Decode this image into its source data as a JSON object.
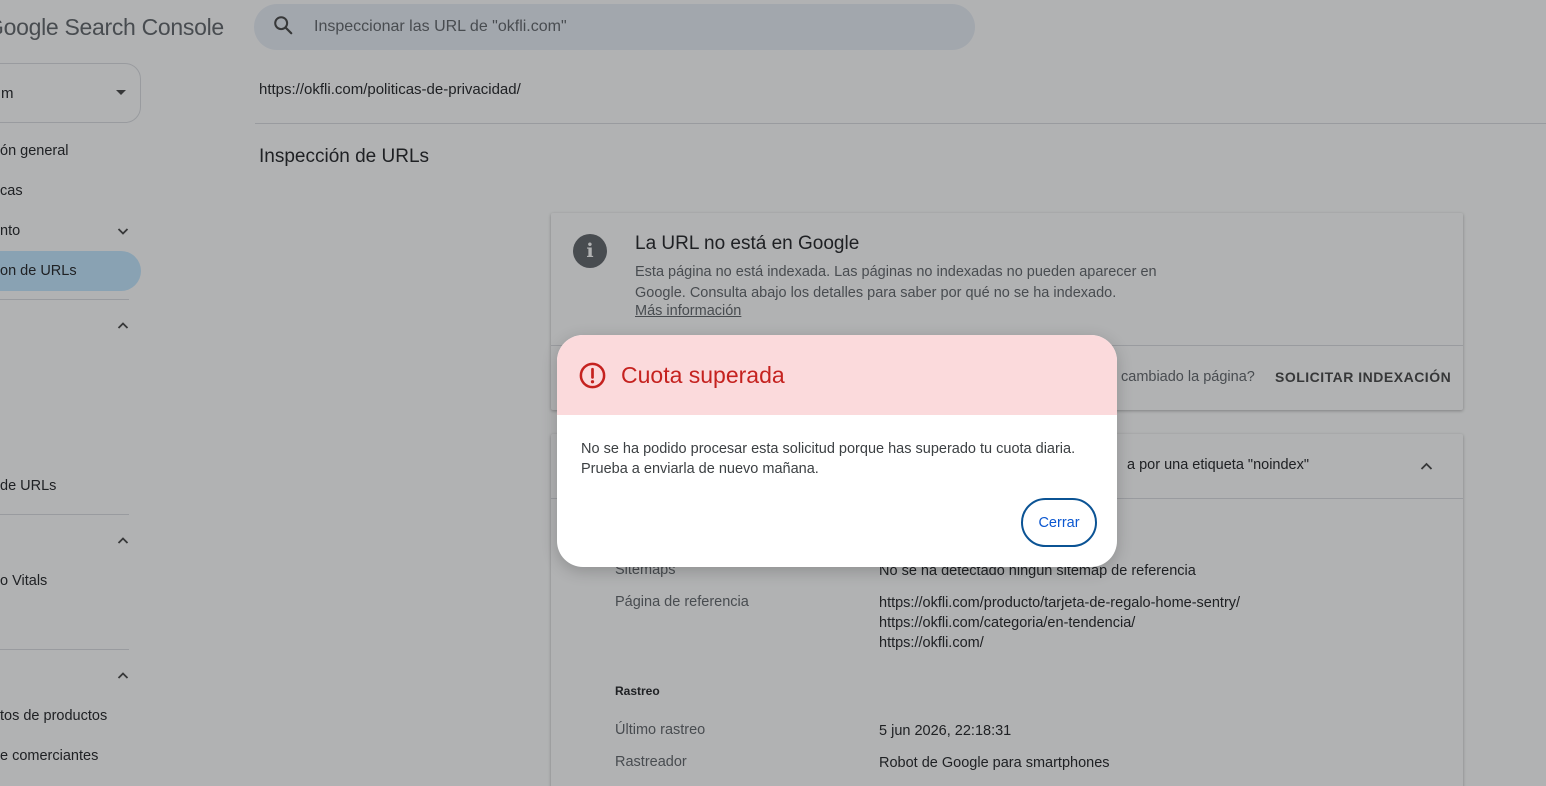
{
  "app": {
    "title": "Google Search Console"
  },
  "search": {
    "placeholder": "Inspeccionar las URL de \"okfli.com\"",
    "icon": "search-icon"
  },
  "property": {
    "label": "m"
  },
  "sidebar": {
    "items": [
      {
        "label": "ón general"
      },
      {
        "label": "cas"
      },
      {
        "label": "nto"
      },
      {
        "label": "on de URLs"
      },
      {
        "label": "de URLs"
      },
      {
        "label": "o Vitals"
      },
      {
        "label": "tos de productos"
      },
      {
        "label": "e comerciantes"
      }
    ]
  },
  "main": {
    "inspected_url": "https://okfli.com/politicas-de-privacidad/",
    "page_title": "Inspección de URLs",
    "status_card": {
      "title": "La URL no está en Google",
      "description": "Esta página no está indexada. Las páginas no indexadas no pueden aparecer en Google. Consulta abajo los detalles para saber por qué no se ha indexado.",
      "link": "Más información",
      "changed_question": "cambiado la página?",
      "request_button": "SOLICITAR INDEXACIÓN"
    },
    "detail_card": {
      "heading": "a por una etiqueta \"noindex\"",
      "rows": [
        {
          "label": "Sitemaps",
          "value": "No se ha detectado ningún sitemap de referencia"
        },
        {
          "label": "Página de referencia",
          "values": [
            "https://okfli.com/producto/tarjeta-de-regalo-home-sentry/",
            "https://okfli.com/categoria/en-tendencia/",
            "https://okfli.com/"
          ]
        }
      ],
      "crawl_section": "Rastreo",
      "crawl_rows": [
        {
          "label": "Último rastreo",
          "value": "5 jun 2026, 22:18:31"
        },
        {
          "label": "Rastreador",
          "value": "Robot de Google para smartphones"
        }
      ]
    }
  },
  "dialog": {
    "title": "Cuota superada",
    "body_line1": "No se ha podido procesar esta solicitud porque has superado tu cuota diaria.",
    "body_line2": "Prueba a enviarla de nuevo mañana.",
    "close_label": "Cerrar",
    "icon": "error-icon",
    "colors": {
      "header_bg": "#fbdadc",
      "title": "#c5221f",
      "button": "#0b57d0"
    }
  }
}
